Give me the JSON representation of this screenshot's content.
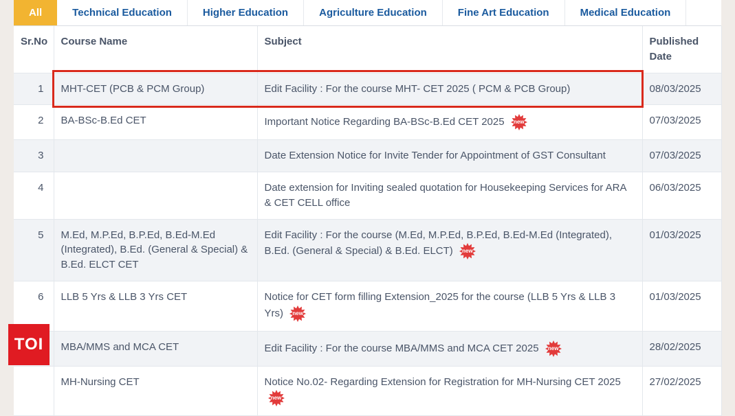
{
  "tabs": [
    {
      "label": "All",
      "active": true
    },
    {
      "label": "Technical Education",
      "active": false
    },
    {
      "label": "Higher Education",
      "active": false
    },
    {
      "label": "Agriculture Education",
      "active": false
    },
    {
      "label": "Fine Art Education",
      "active": false
    },
    {
      "label": "Medical Education",
      "active": false
    }
  ],
  "headers": {
    "sr": "Sr.No",
    "course": "Course Name",
    "subject": "Subject",
    "date": "Published Date"
  },
  "rows": [
    {
      "sr": "1",
      "course": "MHT-CET (PCB & PCM Group)",
      "subject": "Edit Facility : For the course MHT- CET 2025 ( PCM & PCB Group)",
      "date": "08/03/2025",
      "new": false,
      "highlight": true
    },
    {
      "sr": "2",
      "course": "BA-BSc-B.Ed CET",
      "subject": "Important Notice Regarding BA-BSc-B.Ed CET 2025",
      "date": "07/03/2025",
      "new": true,
      "highlight": false
    },
    {
      "sr": "3",
      "course": "",
      "subject": "Date Extension Notice for Invite Tender for Appointment of GST Consultant",
      "date": "07/03/2025",
      "new": false,
      "highlight": false
    },
    {
      "sr": "4",
      "course": "",
      "subject": "Date extension for Inviting sealed quotation for Housekeeping Services for ARA & CET CELL office",
      "date": "06/03/2025",
      "new": false,
      "highlight": false
    },
    {
      "sr": "5",
      "course": "M.Ed, M.P.Ed, B.P.Ed, B.Ed-M.Ed (Integrated), B.Ed. (General & Special) & B.Ed. ELCT CET",
      "subject": "Edit Facility : For the course (M.Ed, M.P.Ed, B.P.Ed, B.Ed-M.Ed (Integrated), B.Ed. (General & Special) & B.Ed. ELCT)",
      "date": "01/03/2025",
      "new": true,
      "highlight": false
    },
    {
      "sr": "6",
      "course": "LLB 5 Yrs & LLB 3 Yrs CET",
      "subject": "Notice for CET form filling Extension_2025 for the course (LLB 5 Yrs & LLB 3 Yrs)",
      "date": "01/03/2025",
      "new": true,
      "highlight": false
    },
    {
      "sr": "",
      "course": "MBA/MMS and MCA CET",
      "subject": "Edit Facility : For the course MBA/MMS and MCA CET 2025",
      "date": "28/02/2025",
      "new": true,
      "highlight": false
    },
    {
      "sr": "",
      "course": "MH-Nursing CET",
      "subject": "Notice No.02- Regarding Extension for Registration for MH-Nursing CET 2025",
      "date": "27/02/2025",
      "new": true,
      "highlight": false
    }
  ],
  "badge": {
    "label": "new"
  },
  "brand": {
    "toi": "TOI"
  }
}
